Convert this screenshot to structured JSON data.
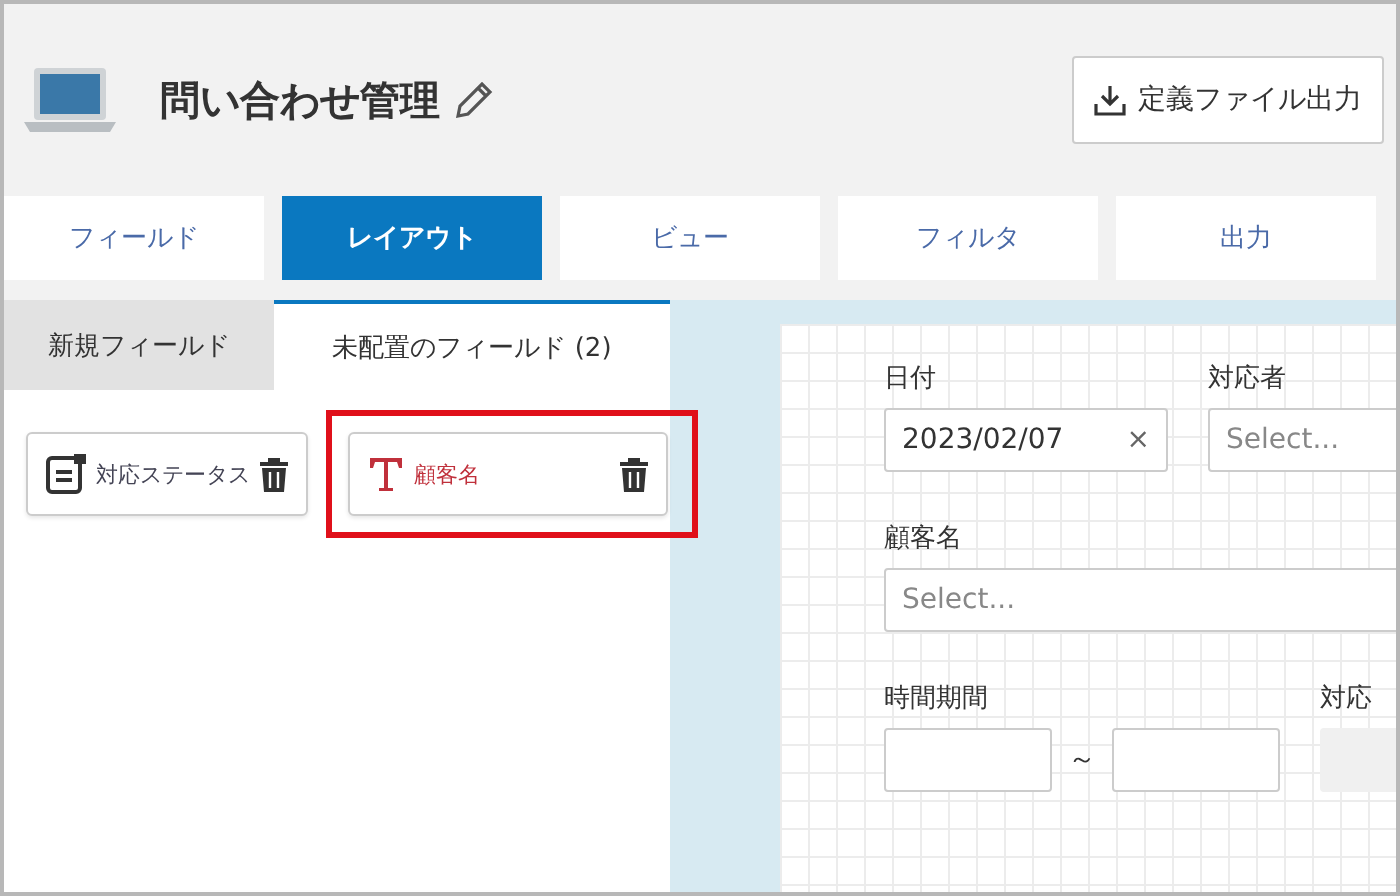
{
  "app": {
    "title": "問い合わせ管理",
    "export_button": "定義ファイル出力"
  },
  "tabs": [
    {
      "label": "フィールド",
      "selected": false
    },
    {
      "label": "レイアウト",
      "selected": true
    },
    {
      "label": "ビュー",
      "selected": false
    },
    {
      "label": "フィルタ",
      "selected": false
    },
    {
      "label": "出力",
      "selected": false
    }
  ],
  "field_panel": {
    "tabs": [
      {
        "label": "新規フィールド",
        "selected": false
      },
      {
        "label": "未配置のフィールド (2)",
        "selected": true
      }
    ],
    "fields": [
      {
        "name": "対応ステータス",
        "kind": "list",
        "highlighted": false
      },
      {
        "name": "顧客名",
        "kind": "text",
        "highlighted": true
      }
    ]
  },
  "canvas": {
    "rows": [
      [
        {
          "label": "日付",
          "kind": "date",
          "value": "2023/02/07",
          "clear": "×"
        },
        {
          "label": "対応者",
          "kind": "select",
          "placeholder": "Select..."
        }
      ],
      [
        {
          "label": "顧客名",
          "kind": "select",
          "placeholder": "Select..."
        }
      ],
      [
        {
          "label": "時間期間",
          "kind": "range",
          "separator": "～"
        },
        {
          "label": "対応",
          "kind": "disabled"
        }
      ]
    ]
  }
}
